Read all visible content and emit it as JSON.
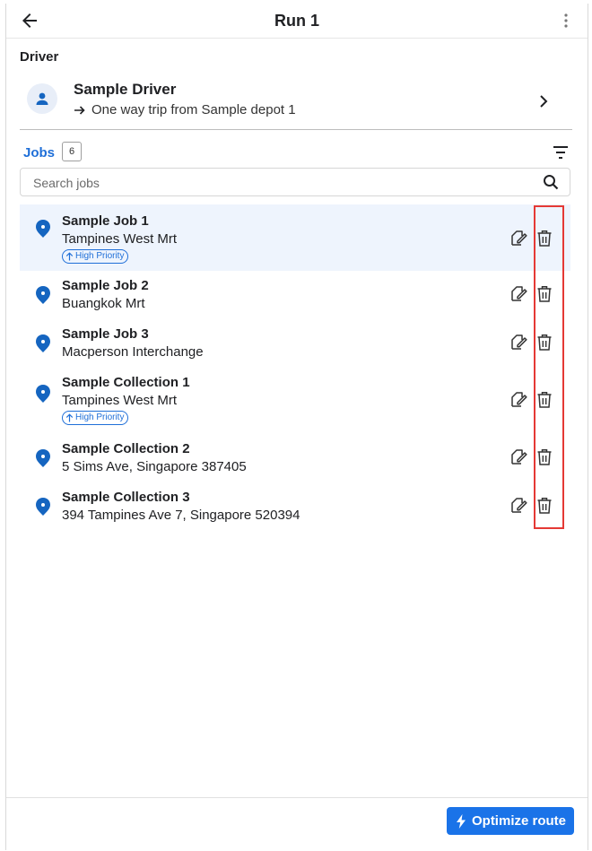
{
  "header": {
    "title": "Run 1",
    "back_icon": "arrow-left-icon",
    "more_icon": "more-vert-icon"
  },
  "driver": {
    "section_label": "Driver",
    "name": "Sample Driver",
    "trip": "One way trip from Sample depot 1"
  },
  "jobs": {
    "label": "Jobs",
    "count": "6",
    "search_placeholder": "Search jobs",
    "items": [
      {
        "title": "Sample Job 1",
        "address": "Tampines West Mrt",
        "badge": "High Priority",
        "selected": true
      },
      {
        "title": "Sample Job 2",
        "address": "Buangkok Mrt",
        "badge": null,
        "selected": false
      },
      {
        "title": "Sample Job 3",
        "address": "Macperson Interchange",
        "badge": null,
        "selected": false
      },
      {
        "title": "Sample Collection 1",
        "address": "Tampines West Mrt",
        "badge": "High Priority",
        "selected": false
      },
      {
        "title": "Sample Collection 2",
        "address": "5 Sims Ave, Singapore 387405",
        "badge": null,
        "selected": false
      },
      {
        "title": "Sample Collection 3",
        "address": "394 Tampines Ave 7, Singapore 520394",
        "badge": null,
        "selected": false
      }
    ]
  },
  "footer": {
    "optimize_label": "Optimize route"
  },
  "colors": {
    "accent": "#1a73e8",
    "pin": "#1565c0",
    "highlight": "#e53935",
    "selected_row": "#eef4fd"
  }
}
